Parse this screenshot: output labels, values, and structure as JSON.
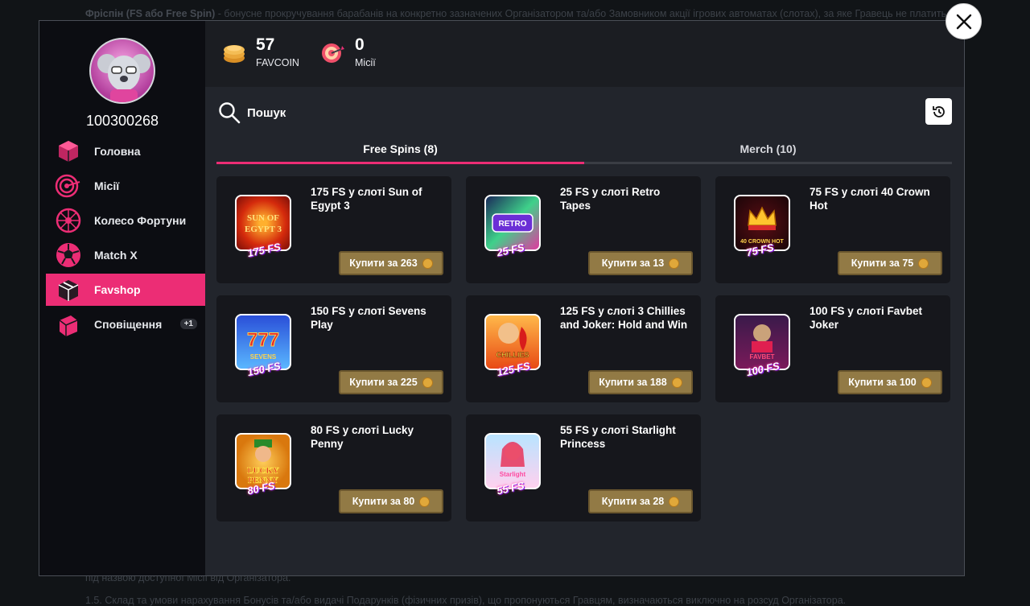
{
  "background": {
    "top_line_bold": "Фріспін (FS або Free Spin)",
    "top_line_rest": " - бонусне прокручування барабанів на конкретно зазначених Організатором та/або Замовником акції ігрових автоматах (слотах), за яке Гравець не платить власні",
    "line2": "під назвою доступної Місії від Організатора.",
    "line3": "1.5. Склад та умови нарахування Бонусів та/або видачі Подарунків (фізичних призів), що пропонуються Гравцям, визначаються виключно на розсуд Організатора."
  },
  "user": {
    "id": "100300268"
  },
  "nav": {
    "items": [
      {
        "label": "Головна",
        "icon": "home-cube-icon"
      },
      {
        "label": "Місії",
        "icon": "target-icon"
      },
      {
        "label": "Колесо Фортуни",
        "icon": "wheel-icon"
      },
      {
        "label": "Match X",
        "icon": "soccer-ball-icon"
      },
      {
        "label": "Favshop",
        "icon": "shop-box-icon",
        "active": true
      },
      {
        "label": "Сповіщення",
        "icon": "notification-box-icon",
        "badge": "+1"
      }
    ]
  },
  "stats": {
    "favcoin": {
      "value": "57",
      "label": "FAVCOIN",
      "icon": "coin-stack-icon"
    },
    "missions": {
      "value": "0",
      "label": "Місії",
      "icon": "target-icon"
    }
  },
  "search": {
    "placeholder": "Пошук"
  },
  "tabs": [
    {
      "label": "Free Spins (8)",
      "active": true
    },
    {
      "label": "Merch (10)",
      "active": false
    }
  ],
  "products": [
    {
      "title": "175 FS у слоті Sun of Egypt 3",
      "fs": "175 FS",
      "price": "Купити за 263",
      "art": "SUN OF EGYPT 3"
    },
    {
      "title": "25 FS у слоті Retro Tapes",
      "fs": "25 FS",
      "price": "Купити за 13",
      "art": "RETRO TAPES"
    },
    {
      "title": "75 FS у слоті 40 Crown Hot",
      "fs": "75 FS",
      "price": "Купити за 75",
      "art": "40 CROWN HOT"
    },
    {
      "title": "150 FS у слоті Sevens Play",
      "fs": "150 FS",
      "price": "Купити за 225",
      "art": "SEVENS PLAY"
    },
    {
      "title": "125 FS у слоті 3 Chillies and Joker: Hold and Win",
      "fs": "125 FS",
      "price": "Купити за 188",
      "art": "3 CHILLIES JOKER"
    },
    {
      "title": "100 FS у слоті Favbet Joker",
      "fs": "100 FS",
      "price": "Купити за 100",
      "art": "FAVBET JOKER"
    },
    {
      "title": "80 FS у слоті Lucky Penny",
      "fs": "80 FS",
      "price": "Купити за 80",
      "art": "LUCKY PENNY"
    },
    {
      "title": "55 FS у слоті Starlight Princess",
      "fs": "55 FS",
      "price": "Купити за 28",
      "art": "Starlight Princess"
    }
  ],
  "colors": {
    "accent": "#ec2d75",
    "button_gold": "#927a45",
    "sidebar_bg": "#0c0d12",
    "card_bg": "#16171c"
  }
}
